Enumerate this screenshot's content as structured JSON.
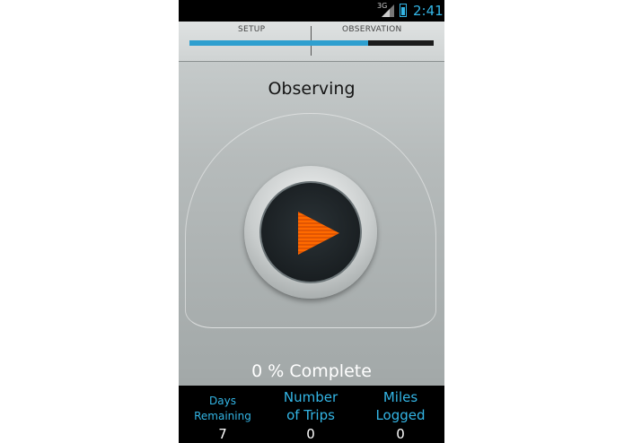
{
  "status_bar": {
    "network": "3G",
    "time": "2:41"
  },
  "progress": {
    "steps": [
      "SETUP",
      "OBSERVATION"
    ],
    "fraction": 0.73,
    "fill_color": "#2e9fcf"
  },
  "main": {
    "title": "Observing",
    "complete_value": "0",
    "complete_label": "% Complete",
    "play_icon": "play-icon"
  },
  "stats": [
    {
      "label_lines": [
        "Days",
        "Remaining"
      ],
      "value": "7"
    },
    {
      "label_lines": [
        "Number",
        "of Trips"
      ],
      "value": "0"
    },
    {
      "label_lines": [
        "Miles",
        "Logged"
      ],
      "value": "0"
    }
  ],
  "colors": {
    "accent": "#33b5e5",
    "play": "#ff6a00"
  }
}
